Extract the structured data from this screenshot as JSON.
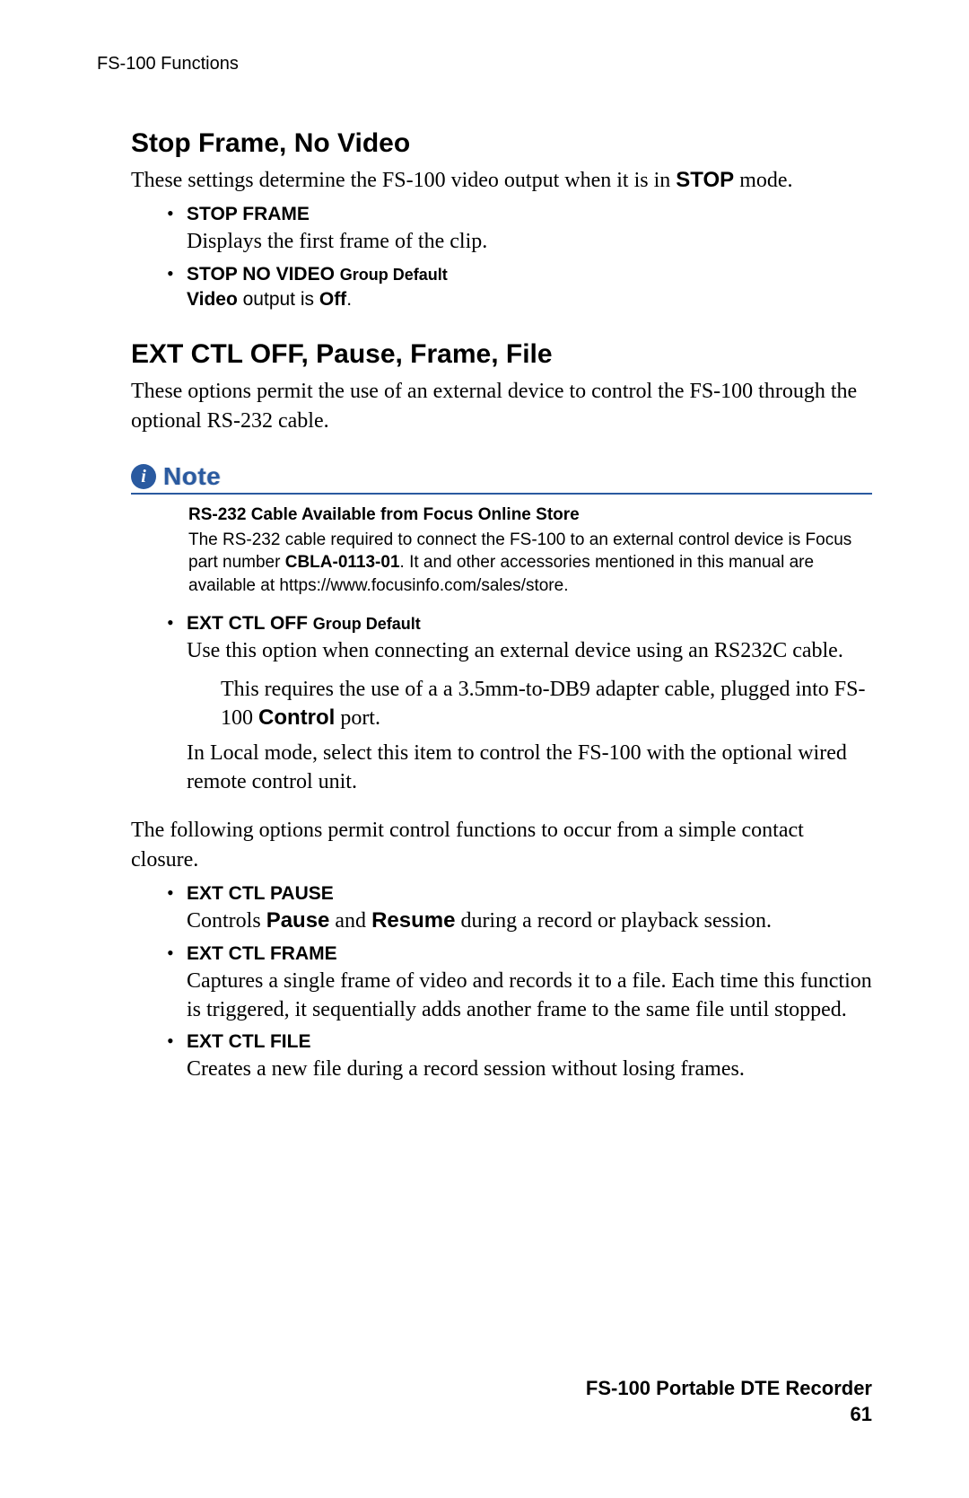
{
  "header": {
    "running": "FS-100 Functions"
  },
  "sections": {
    "s1": {
      "title": "Stop Frame, No Video",
      "intro_a": "These settings determine the FS-100 video output when it is in ",
      "intro_bold": "STOP",
      "intro_b": " mode.",
      "items": {
        "stop_frame": {
          "head": "STOP FRAME",
          "body": "Displays the first frame of the clip."
        },
        "stop_no_video": {
          "head": "STOP NO VIDEO ",
          "tag": "Group Default",
          "body_bold": "Video",
          "body_mid": " output is ",
          "body_bold2": "Off",
          "body_end": "."
        }
      }
    },
    "s2": {
      "title": "EXT CTL OFF, Pause, Frame, File",
      "intro": "These options permit the use of an external device to control the FS-100 through the optional RS-232 cable.",
      "note": {
        "label": "Note",
        "title": "RS-232 Cable Available from Focus Online Store",
        "body_a": "The RS-232 cable required to connect the FS-100 to an external control device is Focus part number ",
        "body_bold": "CBLA-0113-01",
        "body_b": ". It and other accessories mentioned in this manual are available at https://www.focusinfo.com/sales/store."
      },
      "ext_off": {
        "head": "EXT CTL OFF ",
        "tag": "Group Default",
        "body": "Use this option when connecting an external device using an RS232C cable.",
        "sub_a": "This requires the use of a a 3.5mm-to-DB9 adapter cable, plugged into FS-100 ",
        "sub_bold": "Control",
        "sub_b": " port.",
        "body2": "In Local mode, select this item to control the FS-100 with the optional wired remote control unit."
      },
      "followup": "The following options permit control functions to occur from a simple contact closure.",
      "ext_pause": {
        "head": "EXT CTL PAUSE",
        "body_a": "Controls ",
        "body_b1": "Pause",
        "body_mid": " and ",
        "body_b2": "Resume",
        "body_end": " during a record or playback session."
      },
      "ext_frame": {
        "head": "EXT CTL FRAME",
        "body": "Captures a single frame of video and records it to a file. Each time this function is triggered, it sequentially adds another frame to the same file until stopped."
      },
      "ext_file": {
        "head": "EXT CTL FILE",
        "body": "Creates a new file during a record session without losing frames."
      }
    }
  },
  "footer": {
    "product": "FS-100 Portable DTE Recorder",
    "page": "61"
  }
}
